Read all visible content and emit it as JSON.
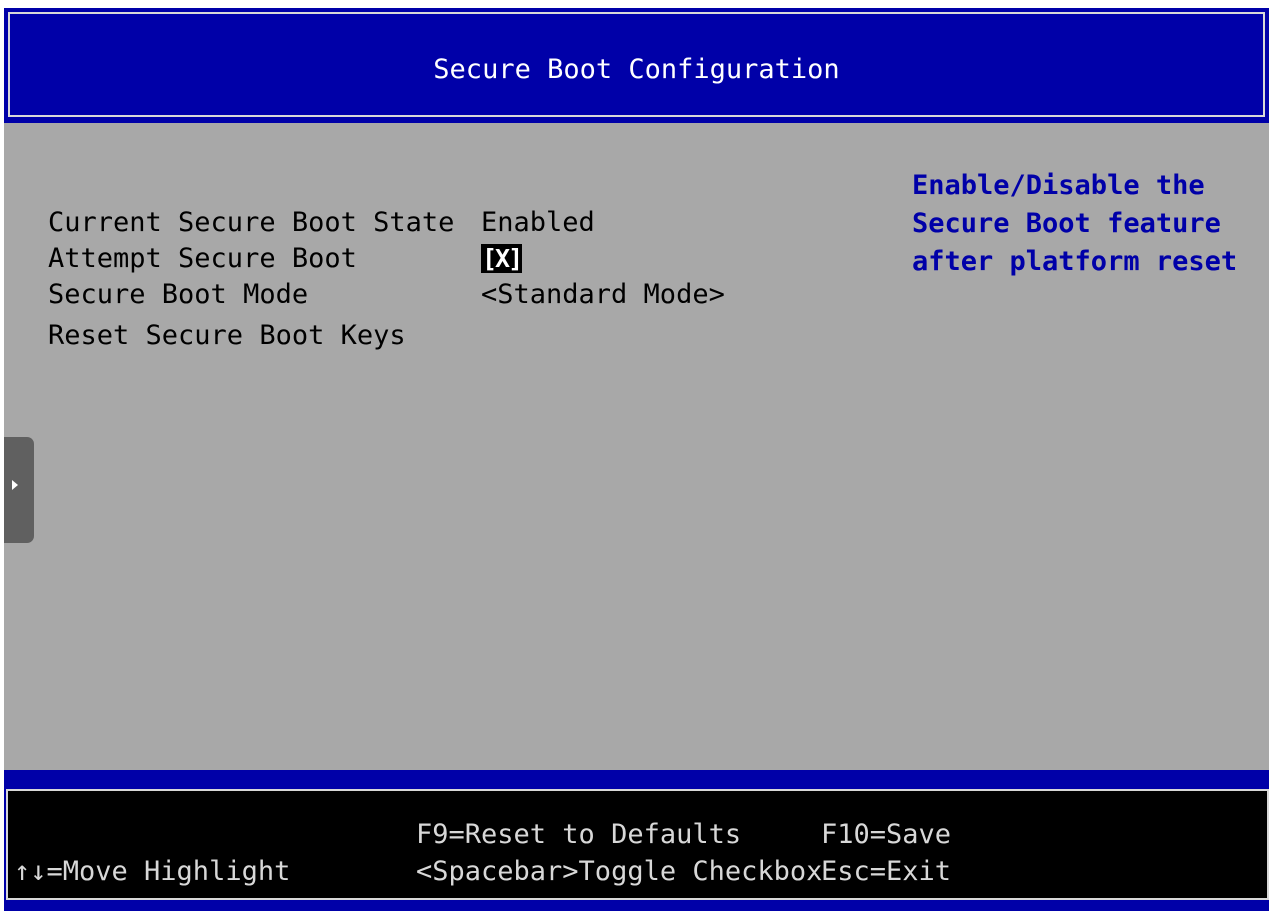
{
  "header": {
    "title": "Secure Boot Configuration"
  },
  "settings": [
    {
      "label": "Current Secure Boot State",
      "value": "Enabled"
    },
    {
      "label": "Attempt Secure Boot",
      "value": "[X]"
    },
    {
      "label": "Secure Boot Mode",
      "value": "<Standard Mode>"
    },
    {
      "label": "Reset Secure Boot Keys",
      "value": ""
    }
  ],
  "help": {
    "lines": [
      "Enable/Disable the",
      "Secure Boot feature",
      "after platform reset"
    ]
  },
  "footer": {
    "move_highlight": "↑↓=Move Highlight",
    "reset_defaults": "F9=Reset to Defaults",
    "toggle_checkbox": "<Spacebar>Toggle Checkbox",
    "save": "F10=Save",
    "exit": "Esc=Exit"
  },
  "colors": {
    "header_bg": "#0000a8",
    "body_bg": "#a8a8a8",
    "help_text": "#0000a8",
    "footer_bg": "#000000"
  },
  "icons": {
    "side_tab": "triangle-right-icon"
  }
}
